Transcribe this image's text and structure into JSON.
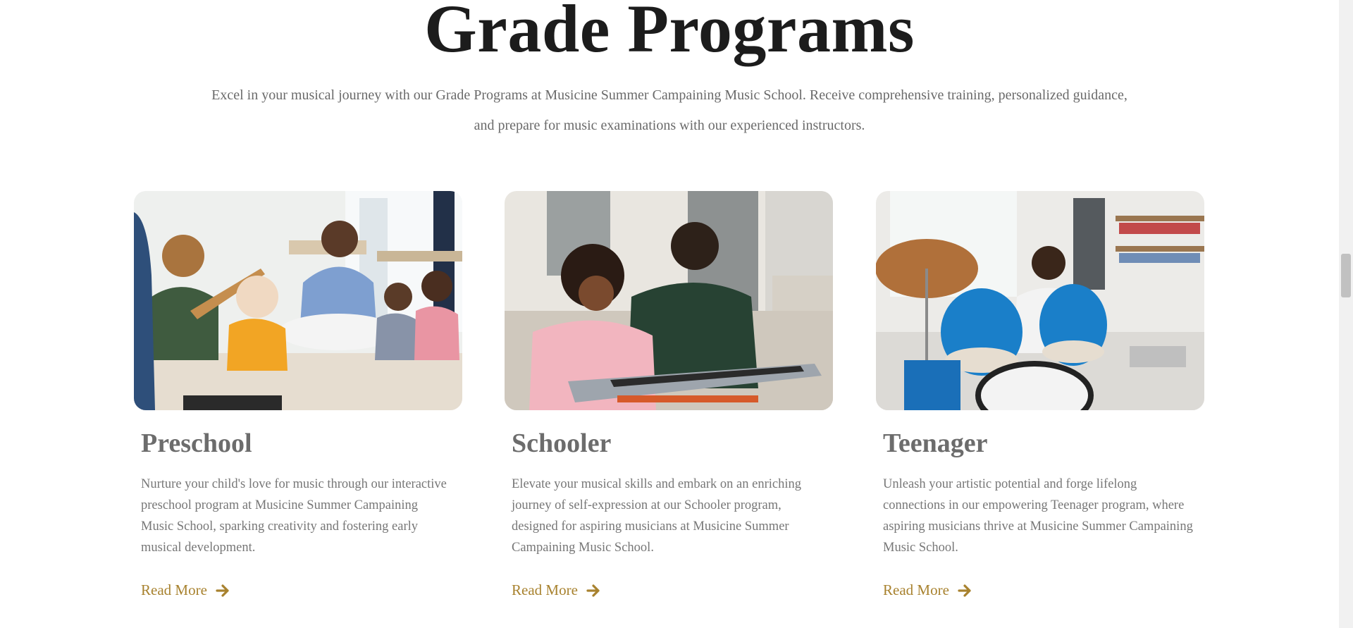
{
  "header": {
    "title": "Grade Programs",
    "intro": "Excel in your musical journey with our Grade Programs at Musicine Summer Campaining Music School. Receive comprehensive training, personalized guidance, and prepare for music examinations with our experienced instructors."
  },
  "programs": [
    {
      "title": "Preschool",
      "description": "Nurture your child's love for music through our interactive preschool program at Musicine Summer Campaining Music School, sparking creativity and fostering early musical development.",
      "link_label": "Read More"
    },
    {
      "title": "Schooler",
      "description": "Elevate your musical skills and embark on an enriching journey of self-expression at our Schooler program, designed for aspiring musicians at Musicine Summer Campaining Music School.",
      "link_label": "Read More"
    },
    {
      "title": "Teenager",
      "description": "Unleash your artistic potential and forge lifelong connections in our empowering Teenager program, where aspiring musicians thrive at Musicine Summer Campaining Music School.",
      "link_label": "Read More"
    }
  ],
  "icons": {
    "link_arrow": "arrow-right-icon"
  },
  "colors": {
    "accent": "#a8822f",
    "heading": "#1c1c1c",
    "body_text": "#777777"
  }
}
